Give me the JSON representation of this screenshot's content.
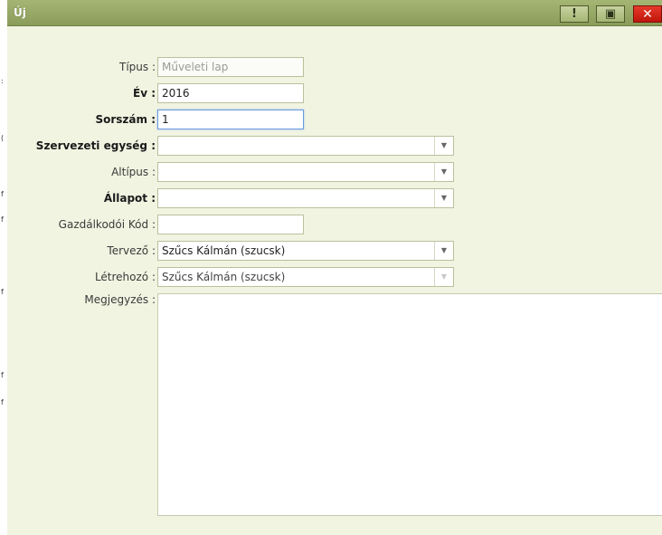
{
  "window": {
    "title": "Új"
  },
  "titlebar": {
    "help_glyph": "!",
    "save_glyph": "▣",
    "close_glyph": "✕"
  },
  "form": {
    "tipus": {
      "label": "Típus :",
      "value": "Műveleti lap"
    },
    "ev": {
      "label": "Év :",
      "value": "2016"
    },
    "sorszam": {
      "label": "Sorszám :",
      "value": "1"
    },
    "szervezeti_egyseg": {
      "label": "Szervezeti egység :",
      "value": ""
    },
    "altipus": {
      "label": "Altípus :",
      "value": ""
    },
    "allapot": {
      "label": "Állapot :",
      "value": ""
    },
    "gazdalkodoi_kod": {
      "label": "Gazdálkodói Kód :",
      "value": ""
    },
    "tervezo": {
      "label": "Tervező :",
      "value": "Szűcs Kálmán (szucsk)"
    },
    "letrehozo": {
      "label": "Létrehozó :",
      "value": "Szűcs Kálmán (szucsk)"
    },
    "megjegyzes": {
      "label": "Megjegyzés :",
      "value": ""
    }
  }
}
